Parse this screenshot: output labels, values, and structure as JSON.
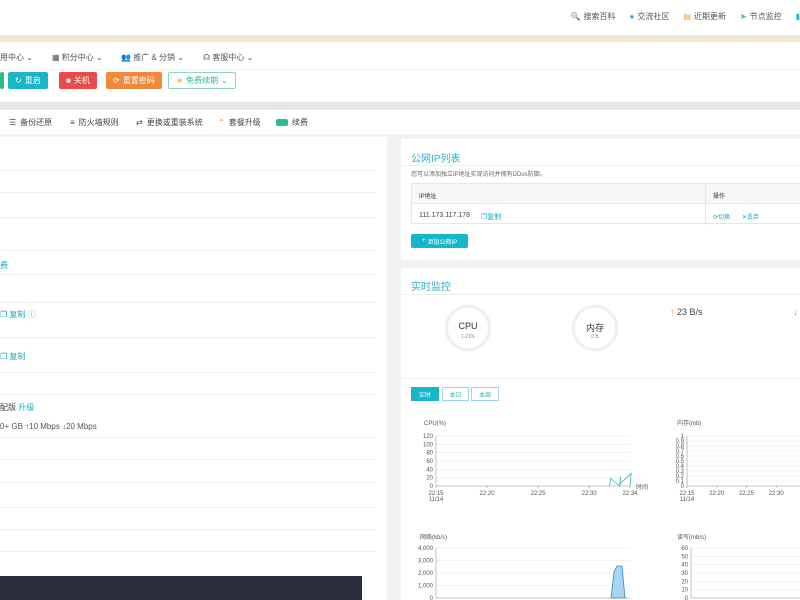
{
  "toplinks": [
    "搜索百科",
    "交流社区",
    "近期更新",
    "节点监控"
  ],
  "nav": [
    "用中心",
    "积分中心",
    "推广 & 分销",
    "客服中心"
  ],
  "actions": [
    "重启",
    "关机",
    "重置密码",
    "免费续期"
  ],
  "tools": [
    "备份还原",
    "防火墙规则",
    "更换或重装系统",
    "套餐升级",
    "续费"
  ],
  "left": {
    "link1": "费",
    "copy": "复制",
    "version": "配版",
    "upgrade": "升级",
    "bandwidth": "0+ GB",
    "up": "10 Mbps",
    "down": "20 Mbps"
  },
  "ip_panel": {
    "title": "公网IP列表",
    "desc": "您可以添加独立IP地址实现访问并拥有DDos防御。",
    "col_ip": "IP地址",
    "col_op": "操作",
    "ip": "111.173.117.178",
    "copy": "复制",
    "switch": "切换",
    "remove": "丢弃",
    "add": "添加公网IP"
  },
  "monitor": {
    "title": "实时监控",
    "cpu_label": "CPU",
    "cpu_val": "1.21%",
    "mem_label": "内存",
    "mem_val": "0 B",
    "up_speed": "23 B/s",
    "tabs": [
      "实时",
      "本日",
      "本周"
    ],
    "cpu_chart_title": "CPU(%)",
    "mem_chart_title": "内存(mb)",
    "net_chart_title": "网络(kb/s)",
    "disk_chart_title": "读写(mb/s)",
    "time_label": "时间"
  },
  "chart_data": [
    {
      "type": "line",
      "title": "CPU(%)",
      "xlabel": "时间",
      "x_ticks": [
        "22:15\n11/14",
        "22:20",
        "22:25",
        "22:30",
        "22:34"
      ],
      "y_ticks": [
        0,
        20,
        40,
        60,
        80,
        100,
        120
      ],
      "ylim": [
        0,
        120
      ],
      "series": [
        {
          "x": [
            "22:32",
            "22:32",
            "22:33",
            "22:33",
            "22:33",
            "22:34",
            "22:34"
          ],
          "y": [
            0,
            18,
            0,
            22,
            5,
            30,
            0
          ]
        }
      ]
    },
    {
      "type": "line",
      "title": "内存(mb)",
      "x_ticks": [
        "22:15\n11/14",
        "22:20",
        "22:25",
        "22:30"
      ],
      "y_ticks": [
        0,
        0.1,
        0.2,
        0.3,
        0.4,
        0.5,
        0.6,
        0.7,
        0.8,
        0.9,
        1
      ],
      "ylim": [
        0,
        1
      ]
    },
    {
      "type": "area",
      "title": "网络(kb/s)",
      "y_ticks": [
        0,
        1000,
        2000,
        3000,
        4000
      ],
      "y_tick_labels": [
        "0",
        "1,000",
        "2,000",
        "3,000",
        "4,000"
      ],
      "ylim": [
        0,
        4000
      ]
    },
    {
      "type": "line",
      "title": "读写(mb/s)",
      "y_ticks": [
        0,
        10,
        20,
        30,
        40,
        50,
        60
      ],
      "ylim": [
        0,
        60
      ]
    }
  ],
  "colors": {
    "accent": "#2eb0c9",
    "green": "#2bbd8a",
    "orange": "#f08a3a",
    "red": "#e94a4a"
  }
}
